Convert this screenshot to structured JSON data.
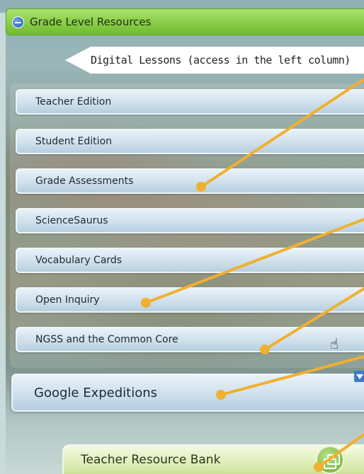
{
  "header": {
    "title": "Grade Level Resources",
    "icon": "minus-icon"
  },
  "digital_lessons": {
    "label": "Digital Lessons (access in the left column)"
  },
  "buttons": [
    {
      "label": "Teacher Edition"
    },
    {
      "label": "Student Edition"
    },
    {
      "label": "Grade Assessments"
    },
    {
      "label": "ScienceSaurus"
    },
    {
      "label": "Vocabulary Cards"
    },
    {
      "label": "Open Inquiry"
    },
    {
      "label": "NGSS and the Common Core"
    }
  ],
  "google_expeditions": {
    "label": "Google Expeditions"
  },
  "teacher_resource_bank": {
    "label": "Teacher Resource Bank",
    "icon": "copy-icon"
  },
  "colors": {
    "header_green": "#8fd14f",
    "callout_orange": "#f0b030",
    "button_blue": "#cfe0ec",
    "resource_bank_green": "#dfeeb7"
  }
}
